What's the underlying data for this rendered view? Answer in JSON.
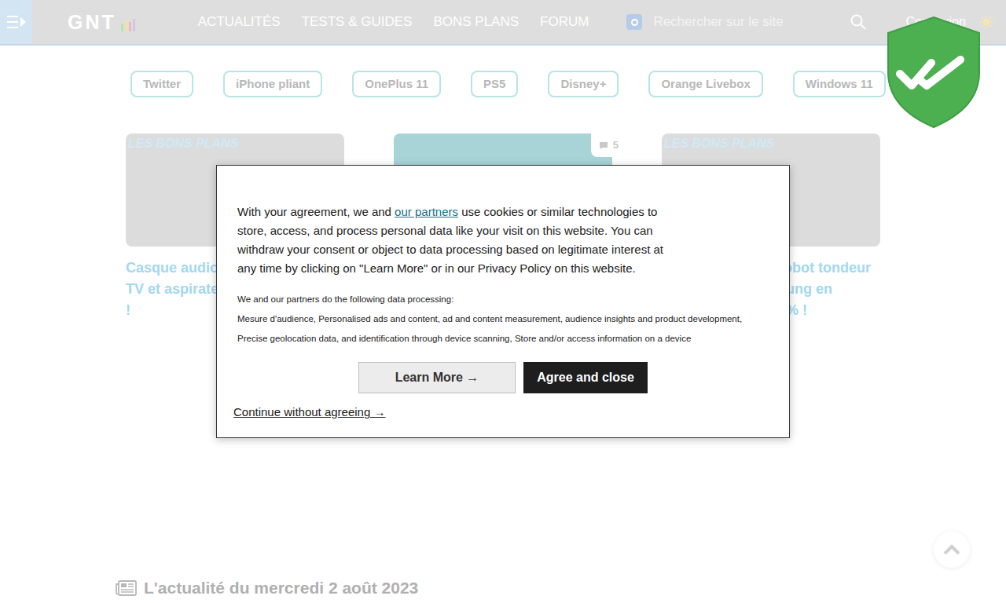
{
  "header": {
    "logo": "GNT",
    "nav": [
      "ACTUALITÉS",
      "TESTS & GUIDES",
      "BONS PLANS",
      "FORUM"
    ],
    "search": {
      "placeholder": "Rechercher sur le site"
    },
    "login": "Connexion"
  },
  "tags": [
    "Twitter",
    "iPhone pliant",
    "OnePlus 11",
    "PS5",
    "Disney+",
    "Orange Livebox",
    "Windows 11"
  ],
  "cards": [
    {
      "ribbon": "LES BONS PLANS",
      "comments": "",
      "title": [
        "Casque audio,",
        "TV et aspirate",
        "!"
      ]
    },
    {
      "ribbon": "",
      "comments": "5",
      "title": []
    },
    {
      "ribbon": "LES BONS PLANS",
      "comments": "",
      "title": [
        "robot tondeur",
        "sung en",
        "4% !"
      ]
    }
  ],
  "section": {
    "heading": "L'actualité du mercredi 2 août 2023"
  },
  "consent": {
    "before_link": "With your agreement, we and ",
    "link": "our partners",
    "after_link": " use cookies or similar technologies to store, access, and process personal data like your visit on this website. You can withdraw your consent or object to data processing based on legitimate interest at any time by clicking on \"Learn More\" or in our Privacy Policy on this website.",
    "purposes_intro": "We and our partners do the following data processing:",
    "purposes": "Mesure d'audience, Personalised ads and content, ad and content measurement, audience insights and product development, Precise geolocation data, and identification through device scanning, Store and/or access information on a device",
    "buttons": [
      "Learn More →",
      "Agree and close"
    ],
    "continue": "Continue without agreeing →"
  }
}
